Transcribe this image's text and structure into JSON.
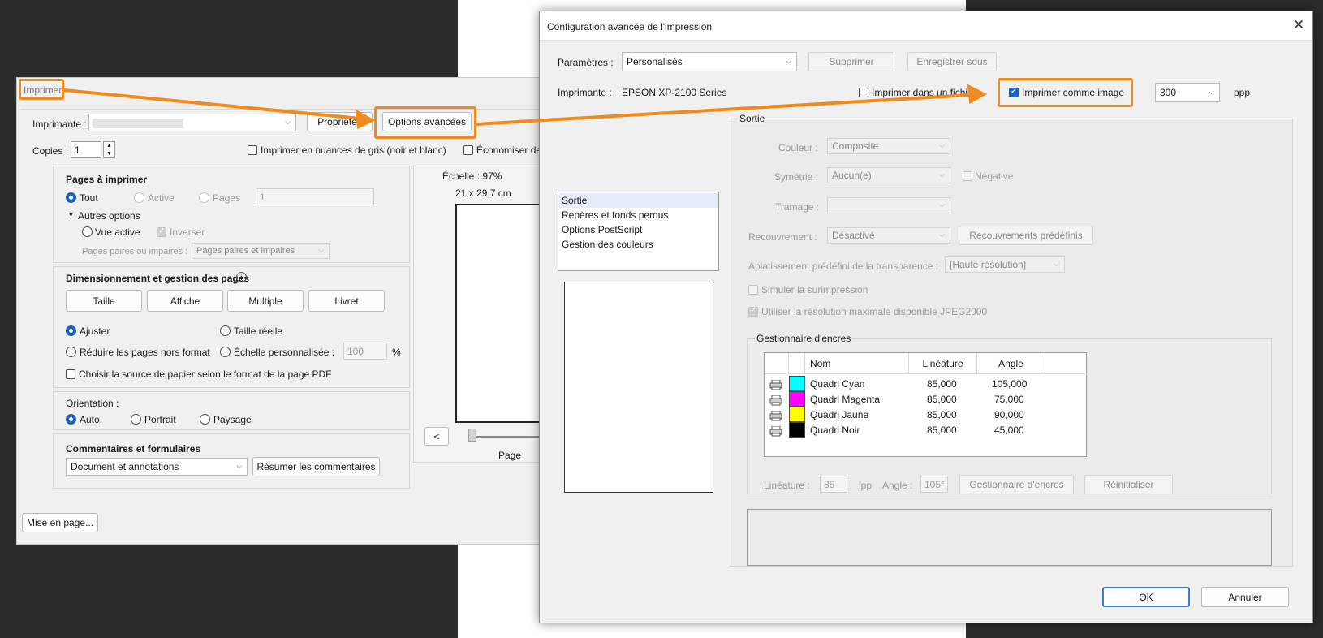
{
  "print_dialog": {
    "title": "Imprimer",
    "printer_label": "Imprimante :",
    "printer_value": "",
    "properties_button": "Propriétés",
    "advanced_button": "Options avancées",
    "copies_label": "Copies :",
    "copies_value": "1",
    "grayscale_label": "Imprimer en nuances de gris (noir et blanc)",
    "save_ink_label": "Économiser de",
    "pages_section": {
      "title": "Pages à imprimer",
      "all": "Tout",
      "current": "Active",
      "pages": "Pages",
      "pages_value": "1",
      "more_options": "Autres options",
      "current_view": "Vue active",
      "reverse": "Inverser",
      "odd_even_label": "Pages paires ou impaires :",
      "odd_even_value": "Pages paires et impaires"
    },
    "sizing_section": {
      "title": "Dimensionnement et gestion des pages",
      "tabs": [
        "Taille",
        "Affiche",
        "Multiple",
        "Livret"
      ],
      "fit": "Ajuster",
      "actual_size": "Taille réelle",
      "shrink": "Réduire les pages hors format",
      "custom_scale": "Échelle personnalisée :",
      "custom_scale_value": "100",
      "percent": "%",
      "paper_source": "Choisir la source de papier selon le format de la page PDF"
    },
    "orientation_section": {
      "title": "Orientation :",
      "auto": "Auto.",
      "portrait": "Portrait",
      "landscape": "Paysage"
    },
    "comments_section": {
      "title": "Commentaires et formulaires",
      "value": "Document et annotations",
      "summarize_button": "Résumer les commentaires"
    },
    "preview": {
      "scale": "Échelle : 97%",
      "size": "21 x 29,7 cm",
      "prev_button": "<",
      "page_label": "Page"
    },
    "page_setup_button": "Mise en page..."
  },
  "advanced_dialog": {
    "title": "Configuration avancée de l'impression",
    "settings_label": "Paramètres :",
    "settings_value": "Personalisés",
    "delete_button": "Supprimer",
    "save_as_button": "Enregistrer sous",
    "printer_label": "Imprimante :",
    "printer_value": "EPSON XP-2100 Series",
    "print_to_file": "Imprimer dans un fichier",
    "print_as_image": "Imprimer comme image",
    "dpi_value": "300",
    "dpi_unit": "ppp",
    "nav_items": [
      "Sortie",
      "Repères et fonds perdus",
      "Options PostScript",
      "Gestion des couleurs"
    ],
    "output": {
      "title": "Sortie",
      "color_label": "Couleur :",
      "color_value": "Composite",
      "flip_label": "Symétrie :",
      "flip_value": "Aucun(e)",
      "negative": "Négative",
      "screening_label": "Tramage :",
      "screening_value": "",
      "trapping_label": "Recouvrement :",
      "trapping_value": "Désactivé",
      "trap_presets_button": "Recouvrements prédéfinis",
      "transparency_label": "Aplatissement prédéfini de la transparence :",
      "transparency_value": "[Haute résolution]",
      "simulate_overprint": "Simuler la surimpression",
      "jpeg2000": "Utiliser la résolution maximale disponible JPEG2000"
    },
    "ink_manager": {
      "title": "Gestionnaire d'encres",
      "columns": [
        "Nom",
        "Linéature",
        "Angle"
      ],
      "rows": [
        {
          "name": "Quadri Cyan",
          "frequency": "85,000",
          "angle": "105,000",
          "color": "#00ffff"
        },
        {
          "name": "Quadri Magenta",
          "frequency": "85,000",
          "angle": "75,000",
          "color": "#ff00ff"
        },
        {
          "name": "Quadri Jaune",
          "frequency": "85,000",
          "angle": "90,000",
          "color": "#ffff00"
        },
        {
          "name": "Quadri Noir",
          "frequency": "85,000",
          "angle": "45,000",
          "color": "#000000"
        }
      ],
      "frequency_label": "Linéature :",
      "frequency_value": "85",
      "lpi": "lpp",
      "angle_label": "Angle :",
      "angle_value": "105°",
      "ink_manager_button": "Gestionnaire d'encres",
      "reset_button": "Réinitialiser"
    },
    "ok_button": "OK",
    "cancel_button": "Annuler",
    "close_icon": "close-icon"
  },
  "colors": {
    "highlight": "#f08a1c",
    "accent": "#1f5fbf"
  }
}
